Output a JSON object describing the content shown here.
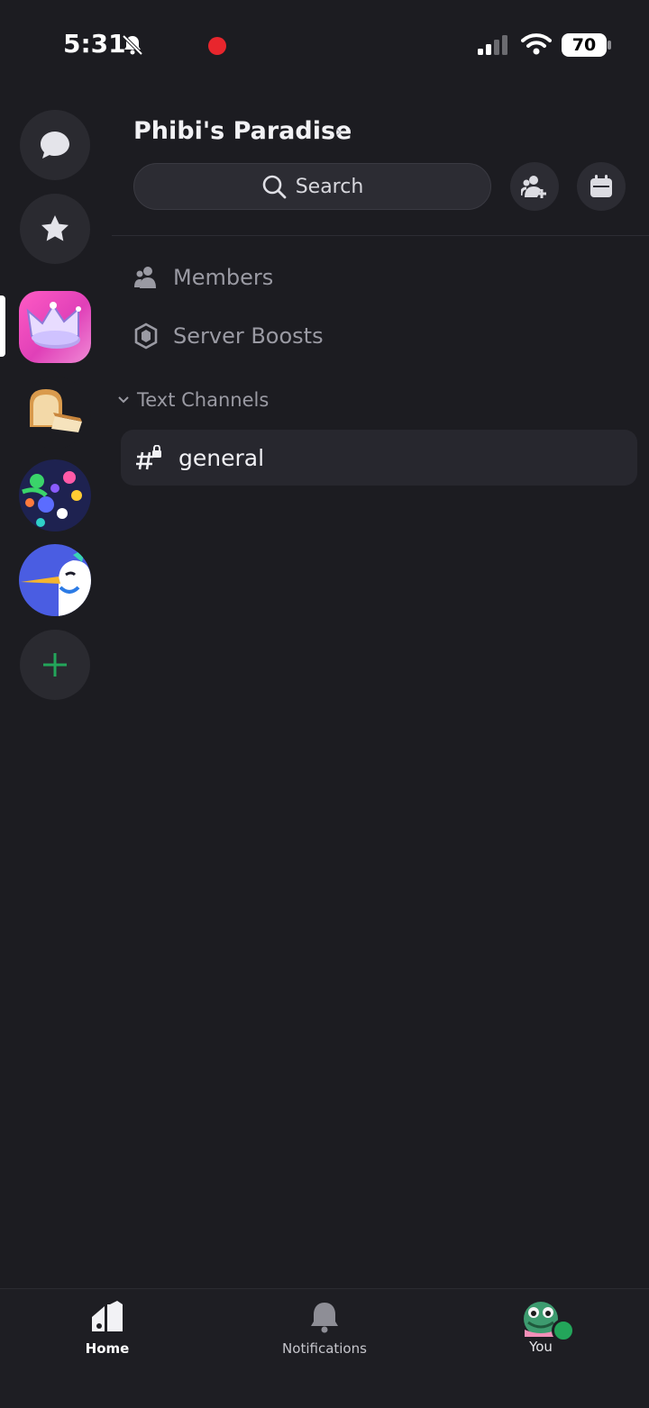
{
  "status_bar": {
    "time": "5:31",
    "battery": "70",
    "icons": [
      "bell-slash-icon",
      "recording-dot-icon",
      "cellular-signal-icon",
      "wifi-icon",
      "battery-icon"
    ]
  },
  "server_rail": {
    "items": [
      {
        "name": "direct-messages",
        "icon": "chat-bubble-icon"
      },
      {
        "name": "discover",
        "icon": "star-icon"
      },
      {
        "name": "phibis-paradise",
        "icon": "crown-server-icon",
        "selected": true
      },
      {
        "name": "bread-server",
        "icon": "bread-server-icon"
      },
      {
        "name": "art-server",
        "icon": "art-server-icon"
      },
      {
        "name": "bird-server",
        "icon": "bird-server-icon"
      },
      {
        "name": "add-server",
        "icon": "plus-icon"
      }
    ]
  },
  "header": {
    "server_name": "Phibi's Paradise",
    "chevron": "›",
    "search_placeholder": "Search",
    "actions": [
      "invite-members-icon",
      "events-calendar-icon"
    ]
  },
  "menu": {
    "members": "Members",
    "server_boosts": "Server Boosts"
  },
  "channels": {
    "section_title": "Text Channels",
    "items": [
      {
        "name": "general",
        "locked": true
      }
    ]
  },
  "tabbar": {
    "home": "Home",
    "notifications": "Notifications",
    "you": "You"
  },
  "colors": {
    "background": "#1c1c21",
    "surface": "#2c2c33",
    "accent_green": "#23a55a",
    "muted_text": "#9a9aa3",
    "recording_red": "#e8262d"
  }
}
